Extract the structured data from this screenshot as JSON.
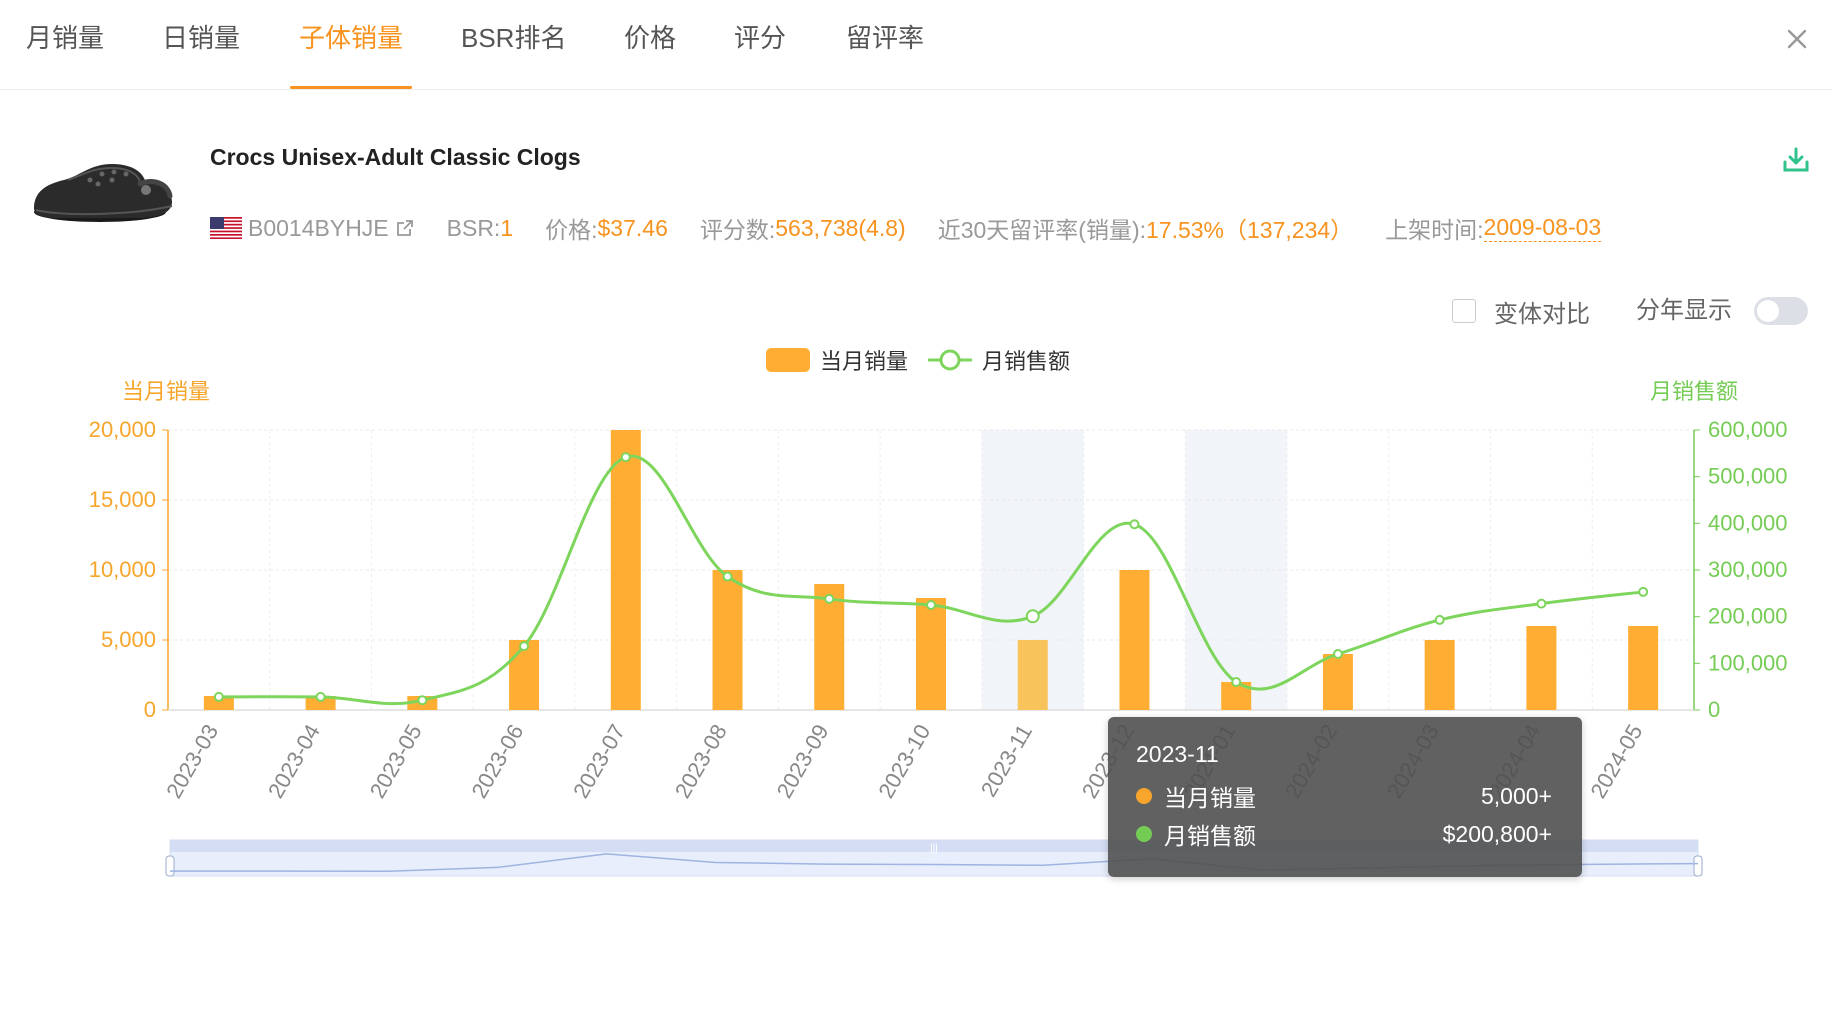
{
  "tabs": [
    {
      "label": "月销量",
      "active": false
    },
    {
      "label": "日销量",
      "active": false
    },
    {
      "label": "子体销量",
      "active": true
    },
    {
      "label": "BSR排名",
      "active": false
    },
    {
      "label": "价格",
      "active": false
    },
    {
      "label": "评分",
      "active": false
    },
    {
      "label": "留评率",
      "active": false
    }
  ],
  "product": {
    "title": "Crocs Unisex-Adult Classic Clogs",
    "asin": "B0014BYHJE",
    "bsr_label": "BSR: ",
    "bsr_value": "1",
    "price_label": "价格: ",
    "price_value": "$37.46",
    "ratings_label": "评分数: ",
    "ratings_value": "563,738(4.8)",
    "review_rate_label": "近30天留评率(销量): ",
    "review_rate_value": "17.53%（137,234）",
    "listed_label": "上架时间: ",
    "listed_value": "2009-08-03"
  },
  "controls": {
    "compare_label": "变体对比",
    "year_label": "分年显示",
    "year_toggle_on": false
  },
  "colors": {
    "accent": "#f7931e",
    "bar": "#ffae33",
    "bar_highlight": "#f7c35a",
    "line": "#7dd55c",
    "left_axis": "#f7a52b",
    "right_axis": "#75cc55"
  },
  "chart_data": {
    "type": "bar",
    "categories": [
      "2023-03",
      "2023-04",
      "2023-05",
      "2023-06",
      "2023-07",
      "2023-08",
      "2023-09",
      "2023-10",
      "2023-11",
      "2023-12",
      "2024-01",
      "2024-02",
      "2024-03",
      "2024-04",
      "2024-05"
    ],
    "series": [
      {
        "name": "当月销量",
        "type": "bar",
        "axis": "left",
        "values": [
          1000,
          1000,
          1000,
          5000,
          20000,
          10000,
          9000,
          8000,
          5000,
          10000,
          2000,
          4000,
          5000,
          6000,
          6000
        ]
      },
      {
        "name": "月销售额",
        "type": "line",
        "axis": "right",
        "values": [
          28000,
          28000,
          21000,
          137000,
          542000,
          286000,
          238000,
          225000,
          200800,
          398000,
          60000,
          120000,
          193000,
          228000,
          253000
        ]
      }
    ],
    "left_axis": {
      "title": "当月销量",
      "min": 0,
      "max": 20000,
      "ticks": [
        "0",
        "5,000",
        "10,000",
        "15,000",
        "20,000"
      ]
    },
    "right_axis": {
      "title": "月销售额",
      "min": 0,
      "max": 600000,
      "ticks": [
        "0",
        "100,000",
        "200,000",
        "300,000",
        "400,000",
        "500,000",
        "600,000"
      ]
    },
    "highlighted_categories": [
      "2023-11",
      "2024-01"
    ],
    "legend_position": "top-center",
    "tooltip": {
      "title": "2023-11",
      "rows": [
        {
          "name": "当月销量",
          "value": "5,000+"
        },
        {
          "name": "月销售额",
          "value": "$200,800+"
        }
      ]
    }
  }
}
